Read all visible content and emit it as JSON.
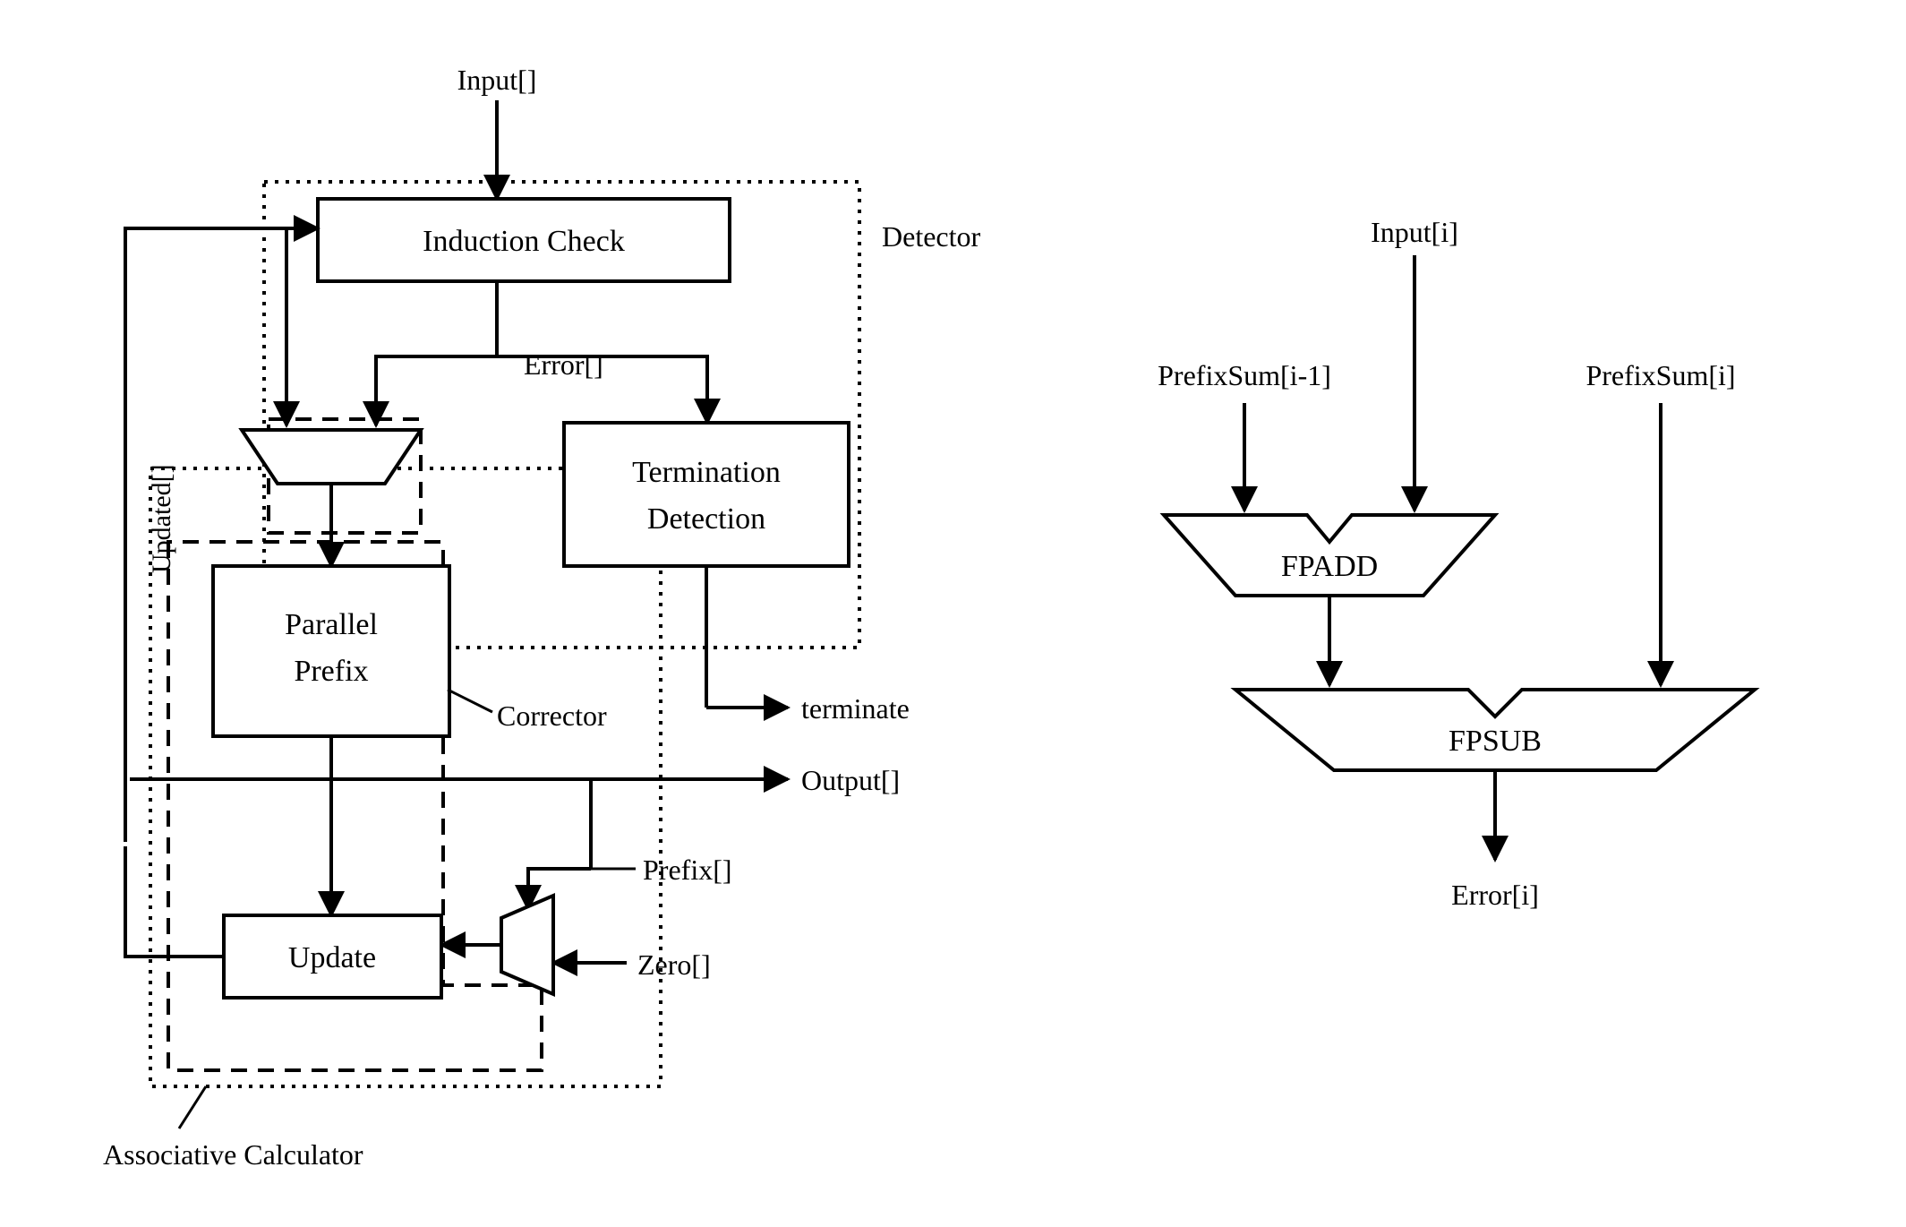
{
  "left": {
    "input": "Input[]",
    "detector_label": "Detector",
    "induction_check": "Induction Check",
    "error_label": "Error[]",
    "termination_detection_l1": "Termination",
    "termination_detection_l2": "Detection",
    "parallel_prefix_l1": "Parallel",
    "parallel_prefix_l2": "Prefix",
    "corrector_label": "Corrector",
    "terminate_label": "terminate",
    "output_label": "Output[]",
    "prefix_label": "Prefix[]",
    "zero_label": "Zero[]",
    "update": "Update",
    "updated_label": "Updated[]",
    "assoc_calc": "Associative Calculator"
  },
  "right": {
    "input_i": "Input[i]",
    "prefix_im1": "PrefixSum[i-1]",
    "prefix_i": "PrefixSum[i]",
    "fpadd": "FPADD",
    "fpsub": "FPSUB",
    "error_i": "Error[i]"
  },
  "colors": {
    "stroke": "#000000"
  }
}
